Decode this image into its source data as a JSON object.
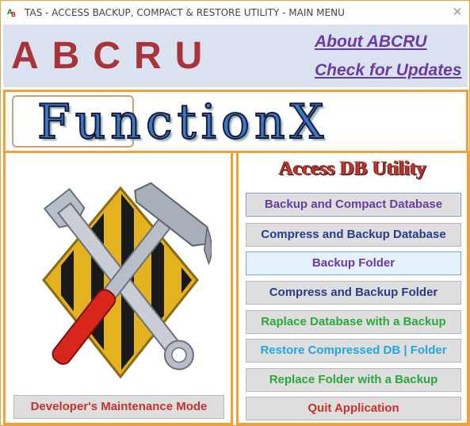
{
  "window": {
    "title": "TAS - ACCESS BACKUP, COMPACT & RESTORE UTILITY - MAIN MENU",
    "close_glyph": "✕"
  },
  "header": {
    "brand": "ABCRU",
    "about_link": "About ABCRU",
    "updates_link": "Check for Updates"
  },
  "banner": {
    "text": "FunctionX"
  },
  "left_panel": {
    "image_icon": "wrench-hammer-icon",
    "dev_button": "Developer's Maintenance Mode"
  },
  "right_panel": {
    "title": "Access DB Utility",
    "buttons": [
      "Backup and Compact Database",
      "Compress and Backup Database",
      "Backup Folder",
      "Compress and Backup Folder",
      "Raplace Database with a Backup",
      "Restore Compressed DB | Folder",
      "Replace Folder with a Backup",
      "Quit Application"
    ]
  },
  "colors": {
    "accent_border": "#f0a23a",
    "header_bg": "#d9e2ee",
    "brand_red": "#a8343a",
    "link_purple": "#6b3aa5",
    "button_bg": "#dedede"
  }
}
